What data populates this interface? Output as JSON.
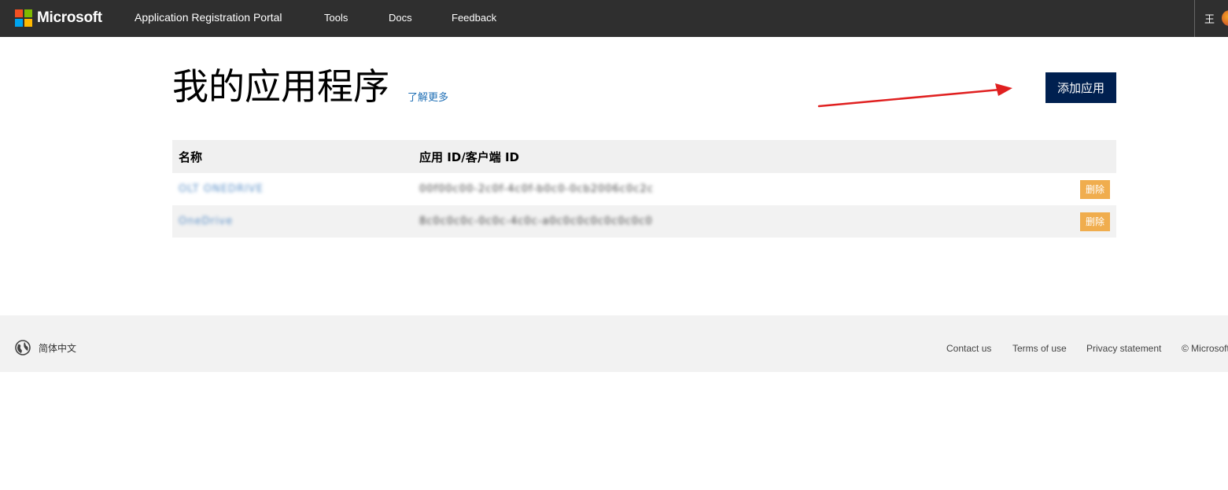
{
  "header": {
    "brand": "Microsoft",
    "logo_colors": [
      "#f25022",
      "#7fba00",
      "#00a4ef",
      "#ffb900"
    ],
    "portal_title": "Application Registration Portal",
    "nav": {
      "tools": "Tools",
      "docs": "Docs",
      "feedback": "Feedback"
    },
    "user_initial": "王"
  },
  "main": {
    "title": "我的应用程序",
    "learn_more": "了解更多",
    "add_app_button": "添加应用",
    "table": {
      "headers": {
        "name": "名称",
        "app_id": "应用 ID/客户端 ID"
      },
      "rows": [
        {
          "name": "OLT ONEDRIVE",
          "app_id": "00f00c00-2c0f-4c0f-b0c0-0cb2006c0c2c",
          "delete_label": "删除"
        },
        {
          "name": "OneDrive",
          "app_id": "8c0c0c0c-0c0c-4c0c-a0c0c0c0c0c0c0c0",
          "delete_label": "删除"
        }
      ]
    }
  },
  "footer": {
    "locale": "简体中文",
    "links": {
      "contact": "Contact us",
      "terms": "Terms of use",
      "privacy": "Privacy statement",
      "copyright": "© Microsoft"
    }
  },
  "colors": {
    "topbar": "#2f2f2f",
    "primary_button": "#002050",
    "delete_button": "#f0ad4e",
    "link": "#1f6fb5",
    "annotation_arrow": "#e02020"
  }
}
